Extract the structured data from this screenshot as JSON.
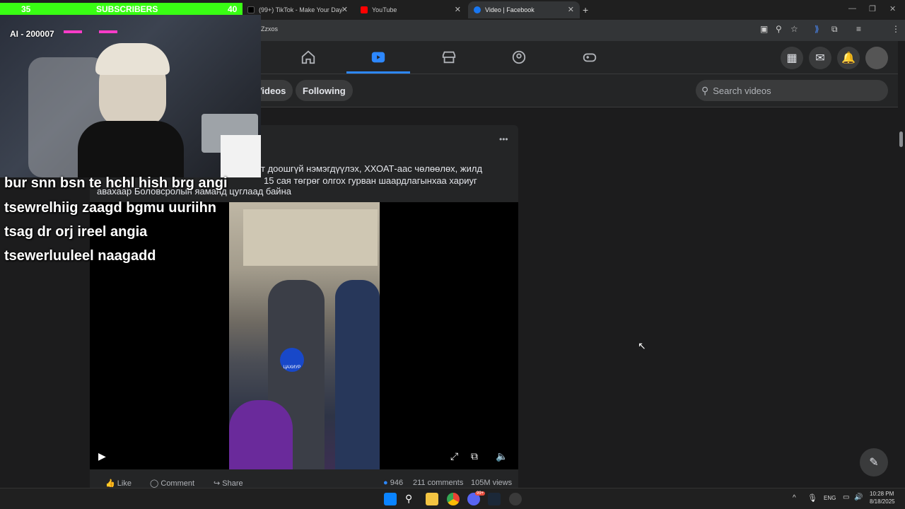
{
  "tabs": [
    {
      "label": "(99+) TikTok - Make Your Day",
      "icon": "tiktok-icon"
    },
    {
      "label": "YouTube",
      "icon": "youtube-icon"
    },
    {
      "label": "Video | Facebook",
      "icon": "facebook-icon"
    }
  ],
  "address": {
    "url": "Zzxos"
  },
  "fb": {
    "subnav": {
      "videos_label": "Videos",
      "following_label": "Following",
      "search_placeholder": "Search videos"
    },
    "post": {
      "caption_line1": "т доошгүй нэмэгдүүлэх, ХХОАТ-аас чөлөөлөх, жилд",
      "caption_line2": "15 сая төгрөг олгох гурван шаардлагынхаа хариуг",
      "caption_line3": "авахаар Боловсролын яаманд цуглаад байна",
      "more_label": "•••",
      "reactions": "946",
      "comments": "211 comments",
      "views": "105M views",
      "like_label": "Like",
      "comment_label": "Comment",
      "share_label": "Share",
      "badge_text": "ЦАХИУР"
    }
  },
  "overlay": {
    "sub_left": "35",
    "sub_title": "SUBSCRIBERS",
    "sub_right": "40",
    "ai_label": "AI - 200007",
    "chat_lines": [
      "bur snn bsn te hchl hish brg angi",
      "tsewrelhiig zaagd bgmu uuriihn",
      "tsag dr orj ireel angia",
      "tsewerluuleel naagadd"
    ]
  },
  "system": {
    "lang": "ENG",
    "time": "10:28 PM",
    "date": "8/18/2025",
    "discord_badge": "99+"
  },
  "colors": {
    "accent": "#2d88ff",
    "sub_bar": "#39ff14",
    "fb_bg": "#1c1c1d"
  }
}
